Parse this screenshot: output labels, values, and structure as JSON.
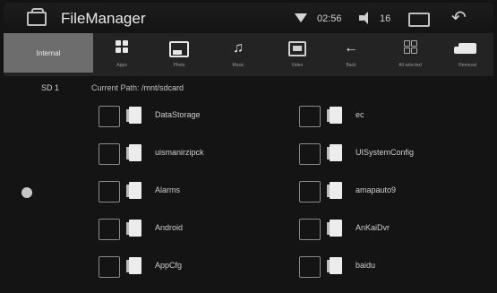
{
  "status_bar": {
    "app_title": "FileManager",
    "time": "02:56",
    "volume_level": "16",
    "icons": [
      "home-icon",
      "wifi-icon",
      "volume-icon",
      "window-icon",
      "back-arrow-icon"
    ]
  },
  "toolbar": {
    "internal_tab": "Internal",
    "tools": [
      {
        "name": "apps",
        "label": "Apps",
        "icon": "grid-icon"
      },
      {
        "name": "photo",
        "label": "Photo",
        "icon": "photo-icon"
      },
      {
        "name": "music",
        "label": "Music",
        "icon": "music-note-icon"
      },
      {
        "name": "video",
        "label": "Video",
        "icon": "video-icon"
      },
      {
        "name": "back",
        "label": "Back",
        "icon": "left-arrow-icon"
      },
      {
        "name": "all-selected",
        "label": "All selected",
        "icon": "apps-outline-icon"
      },
      {
        "name": "removal",
        "label": "Removal",
        "icon": "truck-icon"
      }
    ]
  },
  "sidebar": {
    "sd_label": "SD 1"
  },
  "main": {
    "path_label": "Current Path:",
    "path_value": "/mnt/sdcard",
    "files_left": [
      {
        "name": "DataStorage"
      },
      {
        "name": "uismanirzipck"
      },
      {
        "name": "Alarms"
      },
      {
        "name": "Android"
      },
      {
        "name": "AppCfg"
      }
    ],
    "files_right": [
      {
        "name": "ec"
      },
      {
        "name": "UISystemConfig"
      },
      {
        "name": "amapauto9"
      },
      {
        "name": "AnKaiDvr"
      },
      {
        "name": "baidu"
      }
    ]
  },
  "colors": {
    "background": "#141414",
    "toolbar": "#232323",
    "selected_tab": "#6d6d6d",
    "text": "#cfcfcf"
  }
}
